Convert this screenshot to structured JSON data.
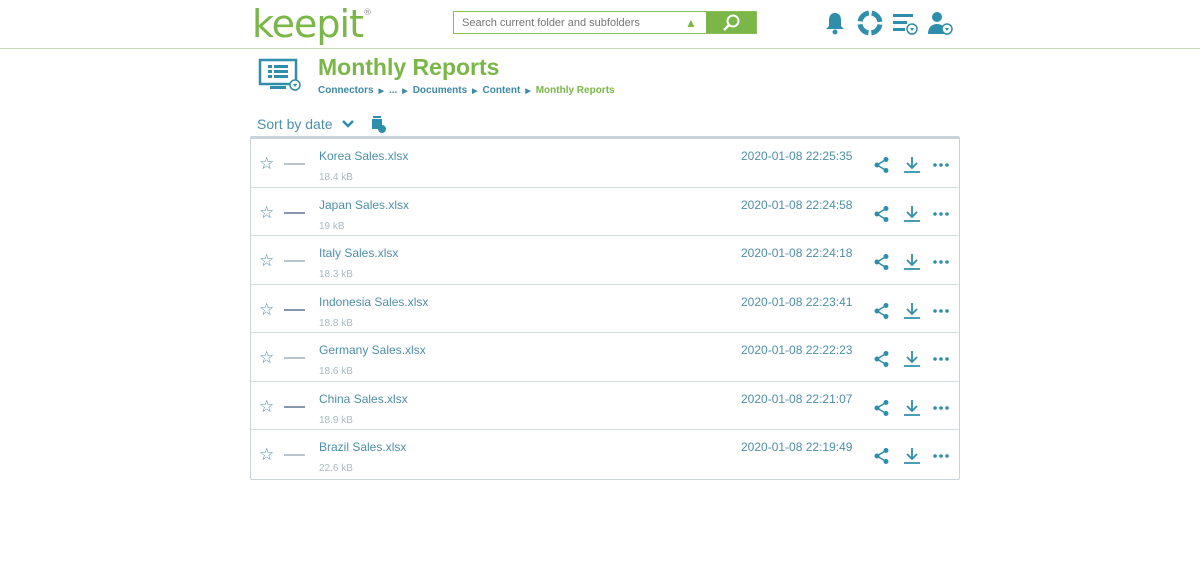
{
  "header": {
    "logo": "keepit",
    "search_placeholder": "Search current folder and subfolders"
  },
  "page": {
    "title": "Monthly Reports",
    "breadcrumb": [
      "Connectors",
      "...",
      "Documents",
      "Content",
      "Monthly Reports"
    ],
    "sort_label": "Sort by date"
  },
  "files": [
    {
      "name": "Korea Sales.xlsx",
      "size": "18.4 kB",
      "date": "2020-01-08 22:25:35"
    },
    {
      "name": "Japan Sales.xlsx",
      "size": "19 kB",
      "date": "2020-01-08 22:24:58"
    },
    {
      "name": "Italy Sales.xlsx",
      "size": "18.3 kB",
      "date": "2020-01-08 22:24:18"
    },
    {
      "name": "Indonesia Sales.xlsx",
      "size": "18.8 kB",
      "date": "2020-01-08 22:23:41"
    },
    {
      "name": "Germany Sales.xlsx",
      "size": "18.6 kB",
      "date": "2020-01-08 22:22:23"
    },
    {
      "name": "China Sales.xlsx",
      "size": "18.9 kB",
      "date": "2020-01-08 22:21:07"
    },
    {
      "name": "Brazil Sales.xlsx",
      "size": "22.6 kB",
      "date": "2020-01-08 22:19:49"
    }
  ]
}
